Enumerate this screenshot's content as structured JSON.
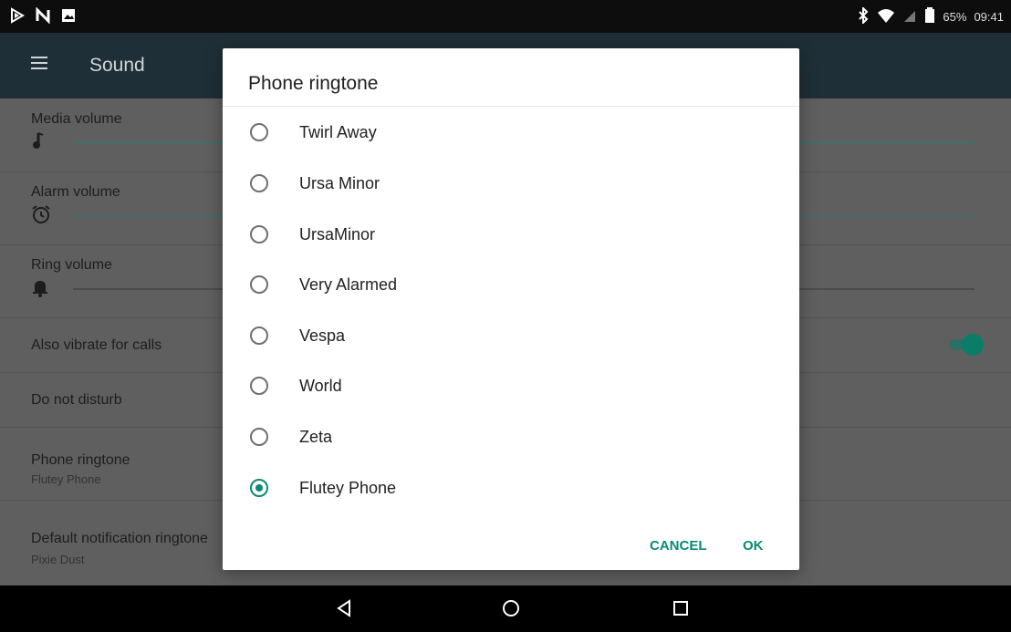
{
  "status_bar": {
    "battery": "65%",
    "time": "09:41",
    "left_icons": [
      "play-arrow-icon",
      "n-icon",
      "image-icon"
    ],
    "right_icons": [
      "bluetooth-icon",
      "wifi-icon",
      "no-sim-icon",
      "battery-icon"
    ]
  },
  "toolbar": {
    "title": "Sound"
  },
  "settings": {
    "media_volume": "Media volume",
    "alarm_volume": "Alarm volume",
    "ring_volume": "Ring volume",
    "vibrate": "Also vibrate for calls",
    "dnd": "Do not disturb",
    "phone_ringtone": "Phone ringtone",
    "phone_ringtone_value": "Flutey Phone",
    "notification_ringtone": "Default notification ringtone",
    "notification_ringtone_value": "Pixie Dust"
  },
  "dialog": {
    "title": "Phone ringtone",
    "options": [
      {
        "label": "Twirl Away",
        "checked": false
      },
      {
        "label": "Ursa Minor",
        "checked": false
      },
      {
        "label": "UrsaMinor",
        "checked": false
      },
      {
        "label": "Very Alarmed",
        "checked": false
      },
      {
        "label": "Vespa",
        "checked": false
      },
      {
        "label": "World",
        "checked": false
      },
      {
        "label": "Zeta",
        "checked": false
      },
      {
        "label": "Flutey Phone",
        "checked": true
      }
    ],
    "cancel": "CANCEL",
    "ok": "OK"
  },
  "colors": {
    "accent": "#0a8a74",
    "toolbar": "#1f2f37",
    "dim_background": "#5f5f5f"
  }
}
